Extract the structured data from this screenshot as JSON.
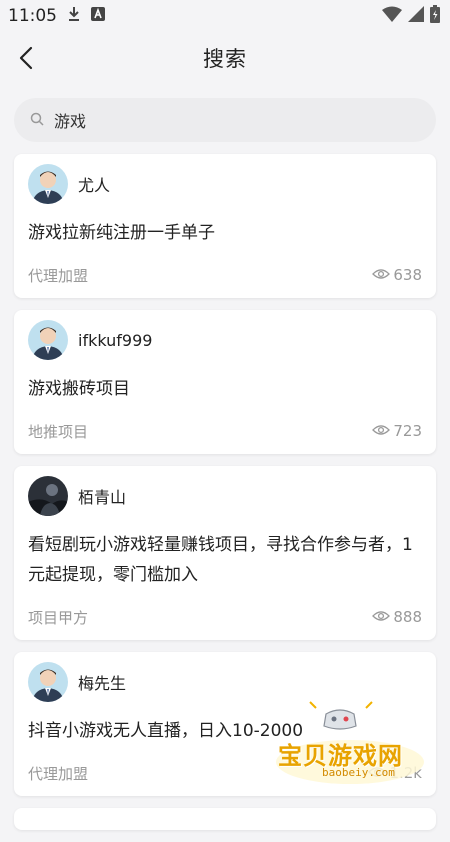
{
  "status_bar": {
    "time": "11:05"
  },
  "header": {
    "title": "搜索"
  },
  "search": {
    "value": "游戏"
  },
  "posts": [
    {
      "author": "尤人",
      "title": "游戏拉新纯注册一手单子",
      "tag": "代理加盟",
      "views": "638",
      "avatar": "man-suit"
    },
    {
      "author": "ifkkuf999",
      "title": "游戏搬砖项目",
      "tag": "地推项目",
      "views": "723",
      "avatar": "man-suit"
    },
    {
      "author": "栢青山",
      "title": "看短剧玩小游戏轻量赚钱项目，寻找合作参与者，1元起提现，零门槛加入",
      "tag": "项目甲方",
      "views": "888",
      "avatar": "photo-dark"
    },
    {
      "author": "梅先生",
      "title": "抖音小游戏无人直播，日入10-2000",
      "tag": "代理加盟",
      "views": "1.2k",
      "avatar": "man-suit"
    }
  ],
  "watermark": {
    "text": "宝贝游戏网",
    "url": "baobeiy.com"
  },
  "colors": {
    "background": "#f4f4f6",
    "card": "#ffffff",
    "muted_text": "#999999",
    "search_bg": "#ececee",
    "watermark": "#e8a300"
  }
}
